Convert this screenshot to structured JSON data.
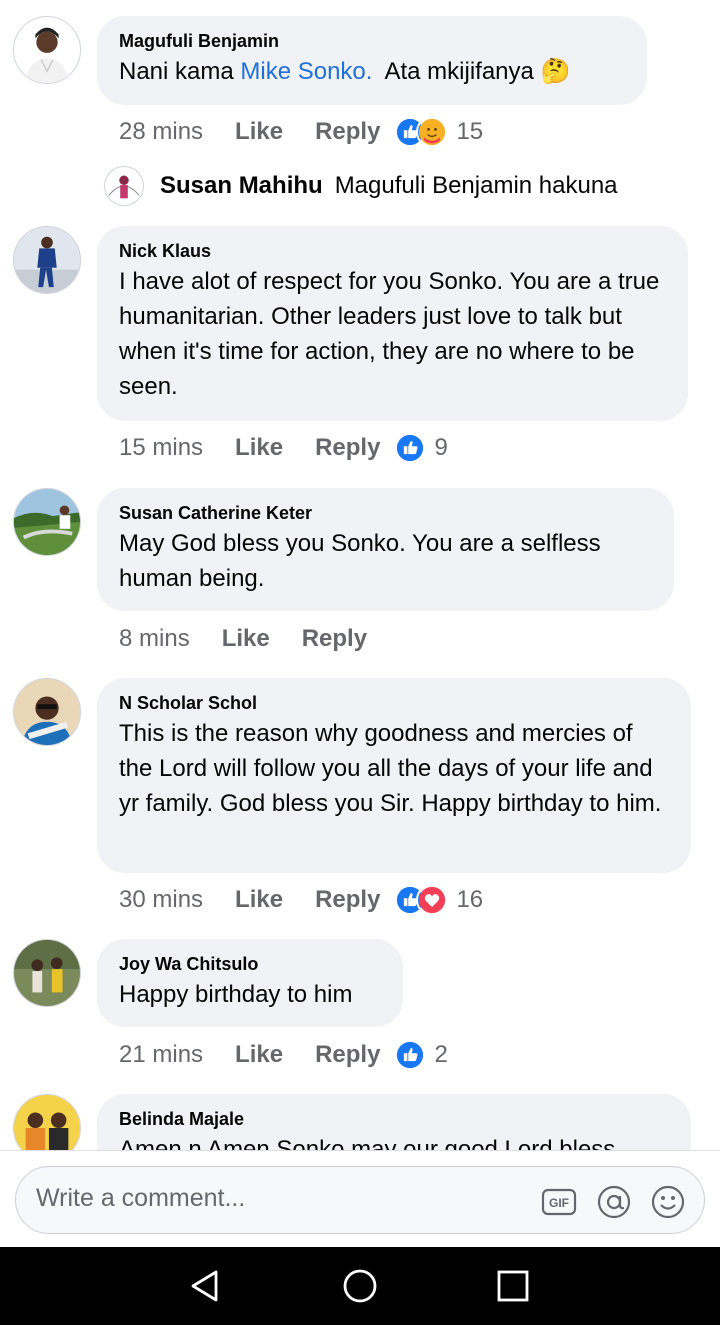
{
  "comments": [
    {
      "author": "Magufuli Benjamin",
      "text_before": "Nani kama ",
      "mention": "Mike Sonko.",
      "text_after": "  Ata mkijifanya ",
      "emoji": "🤔",
      "time": "28 mins",
      "like": "Like",
      "reply": "Reply",
      "reaction_count": "15",
      "reactions": [
        "like-icon",
        "care-icon"
      ],
      "reply_preview": {
        "author": "Susan Mahihu",
        "text": "Magufuli Benjamin hakuna"
      }
    },
    {
      "author": "Nick Klaus",
      "text": "I have alot of respect for you Sonko. You are a true humanitarian. Other leaders just love to talk but when it's time for action, they are no where to be seen.",
      "time": "15 mins",
      "like": "Like",
      "reply": "Reply",
      "reaction_count": "9",
      "reactions": [
        "like-icon"
      ]
    },
    {
      "author": "Susan Catherine Keter",
      "text": "May God bless you Sonko. You are a selfless human being.",
      "time": "8 mins",
      "like": "Like",
      "reply": "Reply"
    },
    {
      "author": "N Scholar Schol",
      "text": "This is the reason why  goodness and mercies of the Lord will follow you all the days of your life and yr family. God bless you Sir. Happy birthday to him.",
      "time": "30 mins",
      "like": "Like",
      "reply": "Reply",
      "reaction_count": "16",
      "reactions": [
        "like-icon",
        "love-icon"
      ]
    },
    {
      "author": "Joy Wa Chitsulo",
      "text": "Happy birthday to him",
      "time": "21 mins",
      "like": "Like",
      "reply": "Reply",
      "reaction_count": "2",
      "reactions": [
        "like-icon"
      ]
    },
    {
      "author": "Belinda Majale",
      "text": "Amen n Amen Sonko may our good Lord bless"
    }
  ],
  "composer": {
    "placeholder": "Write a comment...",
    "icons": [
      "gif-icon",
      "mention-icon",
      "emoji-icon"
    ]
  },
  "navbar": {
    "icons": [
      "back-icon",
      "home-icon",
      "recents-icon"
    ]
  },
  "colors": {
    "bubble": "#f0f2f5",
    "mention": "#216fdb",
    "like": "#1877f2",
    "love": "#f33e58",
    "meta": "#65676b"
  }
}
